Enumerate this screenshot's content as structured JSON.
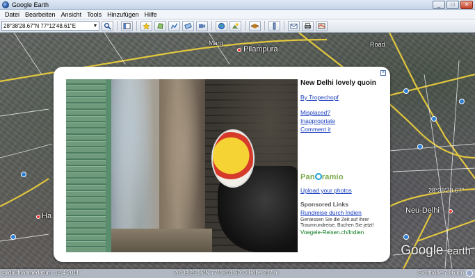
{
  "window": {
    "title": "Google Earth",
    "controls": [
      "_",
      "□",
      "✕"
    ]
  },
  "menu": [
    "Datei",
    "Bearbeiten",
    "Ansicht",
    "Tools",
    "Hinzufügen",
    "Hilfe"
  ],
  "toolbar": {
    "search_value": "28°38'28.67\"N 77°12'48.61\"E",
    "search_icon": "magnifier-icon",
    "tools": [
      "sidebar-icon",
      "placemark-icon",
      "polygon-icon",
      "path-icon",
      "overlay-icon",
      "tour-icon",
      "sky-icon",
      "sun-icon",
      "planet-icon",
      "ruler-icon",
      "email-icon",
      "print-icon",
      "maps-icon"
    ]
  },
  "map": {
    "labels": {
      "pilampura": "Pilampura",
      "ha": "Ha",
      "neu_delhi": "Neu-Delhi",
      "street1": "Marg",
      "street2": "Road"
    },
    "coord_label": "28°38'28.67\"",
    "brand": "Google",
    "brand_suffix": "earth"
  },
  "balloon": {
    "close_icon": "close-icon",
    "title": "New Delhi lovely quoin",
    "author": "By Tropechopf",
    "misplaced": "Misplaced?",
    "inappropriate": "Inappropriate",
    "comment": "Comment it",
    "panoramio_left": "Pan",
    "panoramio_right": "ramio",
    "upload": "Upload your photos",
    "sponsored": "Sponsored Links",
    "ad_title": "Rundreise durch Indien",
    "ad_text": "Geniessen Sie die Zeit auf Ihrer Traumrundreise. Buchen Sie jetzt!",
    "ad_url": "Voegele-Reisen.ch/Indien"
  },
  "status": {
    "image_date": "Bildaufnahmedatum: 12.4.2011",
    "coords": "28°39'25.16\"N 77°08'01.60\"O  Höhe  217 m",
    "eye_alt": "Sichthöhe  7.86 km"
  }
}
